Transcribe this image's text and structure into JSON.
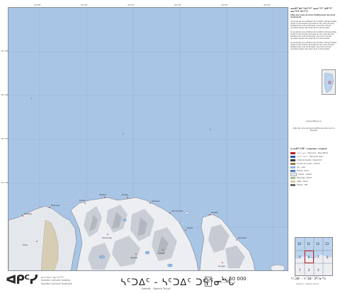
{
  "map": {
    "title_syllabics": "ᓴᑦᑐᐃᑦ - ᓴᑦᑐᐃᑦ ᑐᕌᕐᓂᖓ",
    "title_roman": "Sattuit - Sattuit Tuluit",
    "sheet_number": "6",
    "scale": "1 : 50 000",
    "scale_note": "NAD 83 / UTM Zone 18",
    "bottom_right_syllabics": "ᓴᑦᑐᐃᑦ - ᓴᑦᑐᐃᑦ ᑐᕌᕐᓂᖓ",
    "bottom_right_roman": "Sattuit - Sattuit Tuluit"
  },
  "organization": {
    "logo_text": "ᐊᑭᑦᓯ",
    "line1": "ᐃᓄᒃ ᑲᒪᒪᑦ ᐃᓚᐅᔪᖓ",
    "line2": "Institut culturel Avataq",
    "line3": "Avataq Cultural Institute"
  },
  "sidebar": {
    "heading": "ᓄᓇᕕᒻᒥ ᐃᓕᖅᑯᓯᖏᑦ ᓄᓇᓕᖏᑦ ᐊᑎᖏᑦ ᓄᓇᖏᑕ ᐊᑦᓯᖓ",
    "subheading": "Atlas des noms de lieux traditionnels des Inuit du Nunavik",
    "paragraph": "Ce projet est une initiative de l'Institut culturel Avataq visant a documenter et preserver les noms de lieux traditionnels inuit du Nunavik. Les noms ont ete recueillis aupres des aines de la communaute.",
    "contact_line": "www.avataq.qc.ca",
    "legend_title": "ᓇᓗᓇᐃᖅᓯᒍᑎᑦ | Legende | Legend",
    "legend_items": [
      {
        "label": "ᐊᑎᖓ ᓄᓇᒥ - Toponyme - Place Name",
        "color": "#b02020"
      },
      {
        "label": "ᐊᑎᖓ ᑕᕆᐅᕐᒥ - Toponyme marin",
        "color": "#2a5aa8"
      },
      {
        "label": "Limite de feuillet - Sheet limit",
        "color": "#3a3a3a"
      },
      {
        "label": "Courbe de niveau - Contour",
        "color": "#9a7a4a"
      },
      {
        "label": "Lac - Lake",
        "color": "#8fb5e0"
      },
      {
        "label": "Riviere - River",
        "color": "#4a7ac8"
      },
      {
        "label": "Glacier - Glacier",
        "color": "#e8eef5"
      },
      {
        "label": "Marecage - Marsh",
        "color": "#9ec38a"
      },
      {
        "label": "Sable - Sand",
        "color": "#d9c9a2"
      },
      {
        "label": "Falaise - Cliff",
        "color": "#6a6a6a"
      }
    ],
    "index_cells": [
      "10",
      "11",
      "12",
      "13",
      "5",
      "6",
      "7",
      "8",
      "1",
      "2",
      "3"
    ]
  },
  "grid": {
    "top_labels": [
      "44°45'",
      "44°40'",
      "44°35'",
      "44°30'",
      "44°25'",
      "44°20'"
    ],
    "side_labels": [
      "61°45'",
      "61°40'",
      "61°35'",
      "61°30'"
    ]
  },
  "places": [
    "Qikiqtaq",
    "Ikkarujaq",
    "Nuvuk",
    "Tasialuk",
    "Kangiq",
    "Ujarasuk",
    "Ammalurtuq",
    "Qarliq",
    "Saqqaq",
    "Nunaaluk",
    "Tikirarjuaq",
    "Qaqqaq",
    "Aupaluk",
    "Imaq",
    "Kuugaq"
  ],
  "colors": {
    "water": "#a9c5e6",
    "land": "#e6e9ee",
    "frame": "#8a8f96"
  }
}
